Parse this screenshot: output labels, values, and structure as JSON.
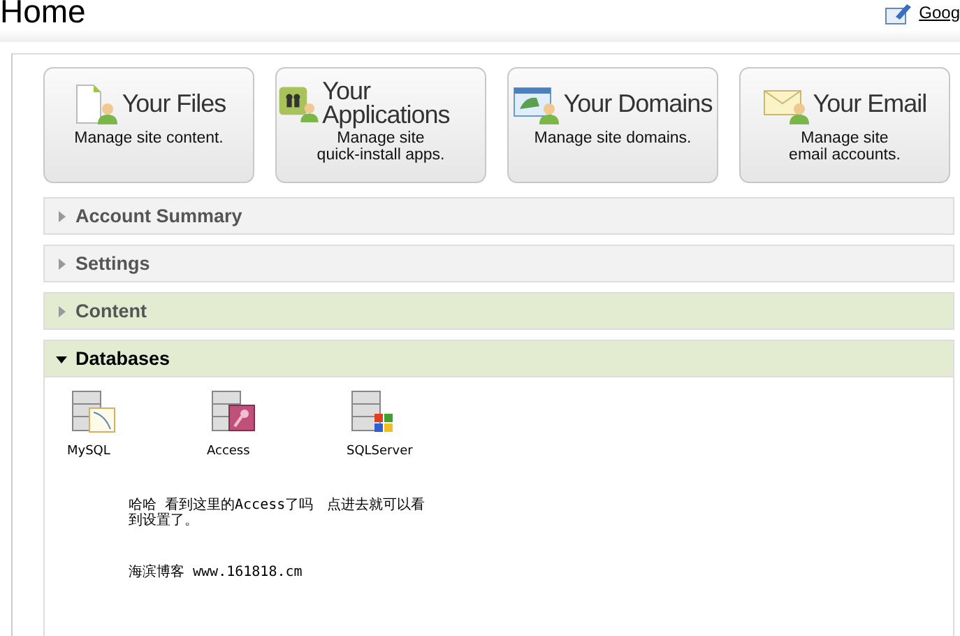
{
  "page_title": "Home",
  "top_link": {
    "label": "Goog"
  },
  "cards": [
    {
      "title": "Your Files",
      "description": "Manage site content.",
      "kind": "files"
    },
    {
      "title": "Your Applications",
      "description": "Manage site\nquick-install apps.",
      "kind": "apps"
    },
    {
      "title": "Your Domains",
      "description": "Manage site domains.",
      "kind": "domains"
    },
    {
      "title": "Your Email",
      "description": "Manage site\nemail accounts.",
      "kind": "email"
    }
  ],
  "sections": [
    {
      "title": "Account Summary",
      "expanded": false,
      "color": "#f2f2f2"
    },
    {
      "title": "Settings",
      "expanded": false,
      "color": "#f2f2f2"
    },
    {
      "title": "Content",
      "expanded": false,
      "color": "#e3ecd0"
    },
    {
      "title": "Databases",
      "expanded": true,
      "color": "#e3ecd0"
    }
  ],
  "databases": [
    {
      "label": "MySQL",
      "kind": "mysql"
    },
    {
      "label": "Access",
      "kind": "access"
    },
    {
      "label": "SQLServer",
      "kind": "sqlserver"
    }
  ],
  "notes": [
    "哈哈 看到这里的Access了吗　点进去就可以看到设置了。",
    "海滨博客 www.161818.cm"
  ]
}
